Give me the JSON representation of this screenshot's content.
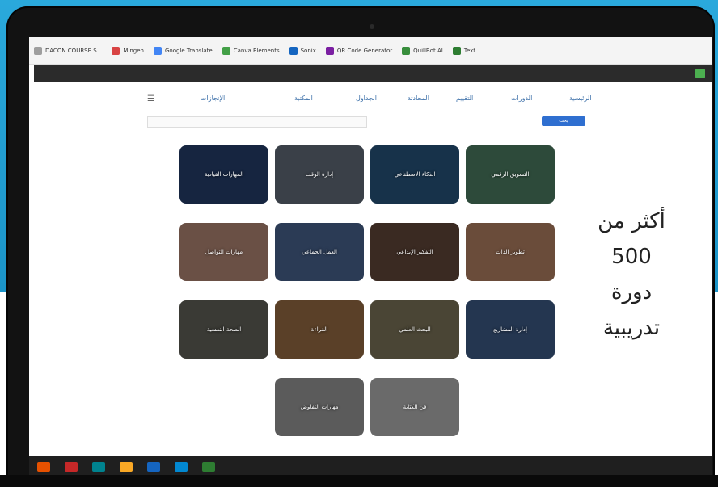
{
  "bookmarks": [
    {
      "label": "DACON COURSE S...",
      "color": "#9e9e9e"
    },
    {
      "label": "Mingen",
      "color": "#d84343"
    },
    {
      "label": "Google Translate",
      "color": "#4285f4"
    },
    {
      "label": "Canva Elements",
      "color": "#43a047"
    },
    {
      "label": "Sonix",
      "color": "#1565c0"
    },
    {
      "label": "QR Code Generator",
      "color": "#7b1fa2"
    },
    {
      "label": "QuillBot AI",
      "color": "#388e3c"
    },
    {
      "label": "Text",
      "color": "#2e7d32"
    }
  ],
  "menu": {
    "items": [
      "الرئيسية",
      "الدورات",
      "التقييم",
      "المحادثة",
      "الجداول",
      "المكتبة",
      "الإنجازات"
    ],
    "search_button": "بحث"
  },
  "cards": [
    {
      "label": "التسويق الرقمي",
      "bg": "#2d4a3a"
    },
    {
      "label": "الذكاء الاصطناعي",
      "bg": "#17324a"
    },
    {
      "label": "إدارة الوقت",
      "bg": "#3a4048"
    },
    {
      "label": "المهارات القيادية",
      "bg": "#162540"
    },
    {
      "label": "تطوير الذات",
      "bg": "#6a4c3a"
    },
    {
      "label": "التفكير الإبداعي",
      "bg": "#3a2a22"
    },
    {
      "label": "العمل الجماعي",
      "bg": "#2b3b55"
    },
    {
      "label": "مهارات التواصل",
      "bg": "#6a5045"
    },
    {
      "label": "إدارة المشاريع",
      "bg": "#243650"
    },
    {
      "label": "البحث العلمي",
      "bg": "#4a4535"
    },
    {
      "label": "القراءة",
      "bg": "#5a4028"
    },
    {
      "label": "الصحة النفسية",
      "bg": "#3a3a35"
    },
    {
      "label": "فن الكتابة",
      "bg": "#6a6a6a"
    },
    {
      "label": "مهارات التفاوض",
      "bg": "#5b5b5b"
    }
  ],
  "headline": [
    "أكثر من",
    "500",
    "دورة",
    "تدريبية"
  ]
}
